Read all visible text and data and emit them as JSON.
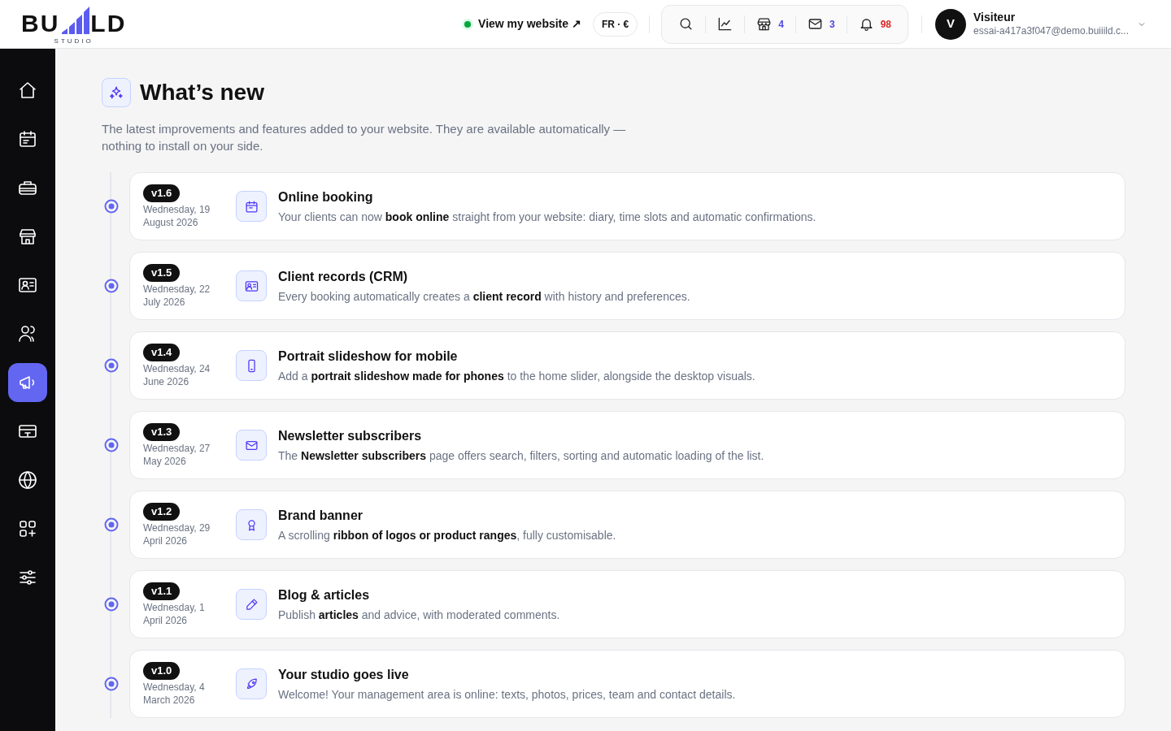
{
  "logo": {
    "left": "BU",
    "right": "LD",
    "subtitle": "STUDIO"
  },
  "header": {
    "site_link": {
      "label": "View my website ↗",
      "online": true
    },
    "locale": "FR · €",
    "tools": [
      {
        "kind": "search"
      },
      {
        "kind": "stats"
      },
      {
        "kind": "shop",
        "count": "4",
        "color": "#4f46e5"
      },
      {
        "kind": "mail",
        "count": "3",
        "color": "#4f46e5"
      },
      {
        "kind": "bell",
        "count": "98",
        "color": "#dc2626"
      }
    ],
    "account": {
      "initial": "V",
      "name": "Visiteur",
      "email": "essai-a417a3f047@demo.buiiild.c..."
    }
  },
  "sidebar": {
    "items": [
      {
        "selected": false
      },
      {
        "selected": false
      },
      {
        "selected": false
      },
      {
        "selected": false
      },
      {
        "selected": false
      },
      {
        "selected": false
      },
      {
        "selected": true
      },
      {
        "selected": false
      },
      {
        "selected": false
      },
      {
        "selected": false
      },
      {
        "selected": false
      }
    ]
  },
  "page": {
    "title": "What’s new",
    "description": "The latest improvements and features added to your website. They are available automatically — nothing to install on your side."
  },
  "releases": [
    {
      "version": "v1.6",
      "date": "Wednesday, 19 August 2026",
      "title": "Online booking",
      "text": "Your clients can now **book online** straight from your website: diary, time slots and automatic confirmations."
    },
    {
      "version": "v1.5",
      "date": "Wednesday, 22 July 2026",
      "title": "Client records (CRM)",
      "text": "Every booking automatically creates a **client record** with history and preferences."
    },
    {
      "version": "v1.4",
      "date": "Wednesday, 24 June 2026",
      "title": "Portrait slideshow for mobile",
      "text": "Add a **portrait slideshow made for phones** to the home slider, alongside the desktop visuals."
    },
    {
      "version": "v1.3",
      "date": "Wednesday, 27 May 2026",
      "title": "Newsletter subscribers",
      "text": "The **Newsletter subscribers** page offers search, filters, sorting and automatic loading of the list."
    },
    {
      "version": "v1.2",
      "date": "Wednesday, 29 April 2026",
      "title": "Brand banner",
      "text": "A scrolling **ribbon of logos or product ranges**, fully customisable."
    },
    {
      "version": "v1.1",
      "date": "Wednesday, 1 April 2026",
      "title": "Blog & articles",
      "text": "Publish **articles** and advice, with moderated comments."
    },
    {
      "version": "v1.0",
      "date": "Wednesday, 4 March 2026",
      "title": "Your studio goes live",
      "text": "Welcome! Your management area is online: texts, photos, prices, team and contact details."
    }
  ]
}
